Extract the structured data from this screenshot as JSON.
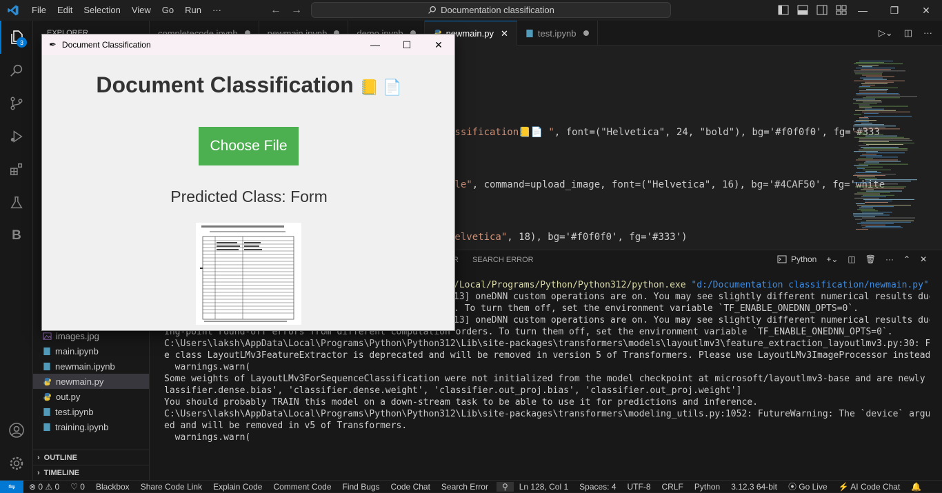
{
  "titlebar": {
    "menu": [
      "File",
      "Edit",
      "Selection",
      "View",
      "Go",
      "Run",
      "···"
    ],
    "search": "Documentation classification"
  },
  "activity": {
    "explorer_badge": "3",
    "blackbox_letter": "B"
  },
  "sidebar": {
    "header": "EXPLORER",
    "files": [
      {
        "name": "images.jpg",
        "icon": "image-file-icon"
      },
      {
        "name": "main.ipynb",
        "icon": "notebook-file-icon"
      },
      {
        "name": "newmain.ipynb",
        "icon": "notebook-file-icon"
      },
      {
        "name": "newmain.py",
        "icon": "python-file-icon"
      },
      {
        "name": "out.py",
        "icon": "python-file-icon"
      },
      {
        "name": "test.ipynb",
        "icon": "notebook-file-icon"
      },
      {
        "name": "training.ipynb",
        "icon": "notebook-file-icon"
      }
    ],
    "outline": "OUTLINE",
    "timeline": "TIMELINE"
  },
  "tabs": [
    {
      "label": "completecode.ipynb",
      "modified": true
    },
    {
      "label": "newmain.ipynb",
      "modified": true
    },
    {
      "label": "demo.ipynb",
      "modified": true
    },
    {
      "label": "newmain.py",
      "active": true
    },
    {
      "label": "test.ipynb",
      "modified": true
    }
  ],
  "editor": {
    "line1_str": "assification📒📄 \"",
    "line1_rest": ", font=(\"Helvetica\", 24, \"bold\"), bg='#f0f0f0', fg='#333",
    "line2_str": "ile\"",
    "line2_rest": ", command=upload_image, font=(\"Helvetica\", 16), bg='#4CAF50', fg='white",
    "line3_str": "Helvetica\"",
    "line3_rest": ", 18), bg='#f0f0f0', fg='#333')"
  },
  "panel": {
    "tab_partial": "R",
    "tab_search_error": "SEARCH ERROR",
    "shell": "Python",
    "terminal": [
      "/Local/Programs/Python/Python312/python.exe \"d:/Documentation classification/newmain.py\"",
      "13] oneDNN custom operations are on. You may see slightly different numerical results due to float",
      ". To turn them off, set the environment variable `TF_ENABLE_ONEDNN_OPTS=0`.",
      "13] oneDNN custom operations are on. You may see slightly different numerical results due to float",
      "ing-point round-off errors from different computation orders. To turn them off, set the environment variable `TF_ENABLE_ONEDNN_OPTS=0`.",
      "C:\\Users\\laksh\\AppData\\Local\\Programs\\Python\\Python312\\Lib\\site-packages\\transformers\\models\\layoutlmv3\\feature_extraction_layoutlmv3.py:30: FutureWarning: Th",
      "e class LayoutLMv3FeatureExtractor is deprecated and will be removed in version 5 of Transformers. Please use LayoutLMv3ImageProcessor instead.",
      "  warnings.warn(",
      "Some weights of LayoutLMv3ForSequenceClassification were not initialized from the model checkpoint at microsoft/layoutlmv3-base and are newly initialized: ['c",
      "lassifier.dense.bias', 'classifier.dense.weight', 'classifier.out_proj.bias', 'classifier.out_proj.weight']",
      "You should probably TRAIN this model on a down-stream task to be able to use it for predictions and inference.",
      "C:\\Users\\laksh\\AppData\\Local\\Programs\\Python\\Python312\\Lib\\site-packages\\transformers\\modeling_utils.py:1052: FutureWarning: The `device` argument is deprecat",
      "ed and will be removed in v5 of Transformers.",
      "  warnings.warn("
    ]
  },
  "statusbar": {
    "errors": "0",
    "warnings": "0",
    "ports": "0",
    "items_left": [
      "Blackbox",
      "Share Code Link",
      "Explain Code",
      "Comment Code",
      "Find Bugs",
      "Code Chat",
      "Search Error"
    ],
    "position": "Ln 128, Col 1",
    "spaces": "Spaces: 4",
    "encoding": "UTF-8",
    "eol": "CRLF",
    "language": "Python",
    "interpreter": "3.12.3 64-bit",
    "golive": "Go Live",
    "aichat": "AI Code Chat"
  },
  "tkwindow": {
    "title": "Document Classification",
    "heading": "Document Classification",
    "heading_emoji": "📒 📄",
    "button": "Choose File",
    "predicted": "Predicted Class: Form"
  },
  "colors": {
    "accent": "#0078d4",
    "button_green": "#4CAF50",
    "window_bg": "#f0f0f0",
    "text_dark": "#333333"
  }
}
